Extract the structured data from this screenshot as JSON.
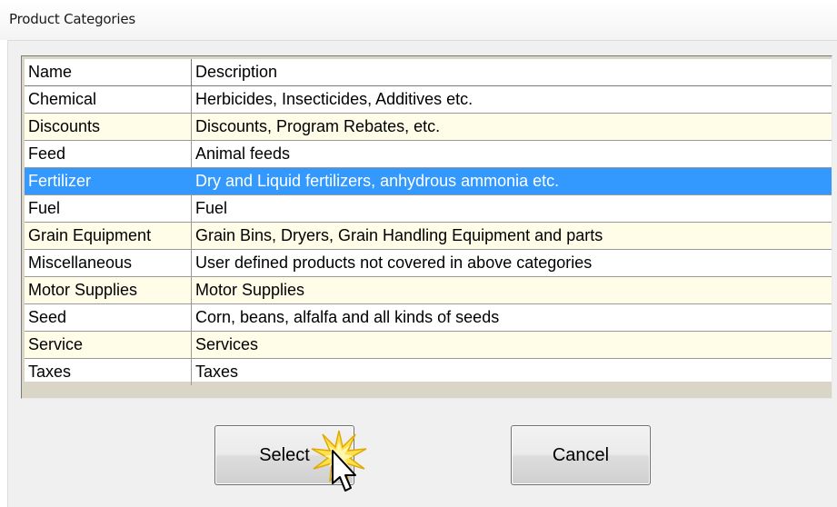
{
  "window": {
    "title": "Product Categories"
  },
  "grid": {
    "columns": [
      "Name",
      "Description"
    ],
    "rows": [
      {
        "name": "Chemical",
        "description": "Herbicides, Insecticides, Additives etc."
      },
      {
        "name": "Discounts",
        "description": "Discounts, Program Rebates, etc."
      },
      {
        "name": "Feed",
        "description": "Animal feeds"
      },
      {
        "name": "Fertilizer",
        "description": "Dry and Liquid fertilizers, anhydrous ammonia etc."
      },
      {
        "name": "Fuel",
        "description": "Fuel"
      },
      {
        "name": "Grain Equipment",
        "description": "Grain Bins, Dryers, Grain Handling Equipment and parts"
      },
      {
        "name": "Miscellaneous",
        "description": "User defined products not covered in above categories"
      },
      {
        "name": "Motor Supplies",
        "description": "Motor Supplies"
      },
      {
        "name": "Seed",
        "description": "Corn, beans, alfalfa and all kinds of seeds"
      },
      {
        "name": "Service",
        "description": "Services"
      },
      {
        "name": "Taxes",
        "description": "Taxes"
      }
    ],
    "selected_row": "Fertilizer"
  },
  "buttons": {
    "select_label": "Select",
    "cancel_label": "Cancel"
  },
  "colors": {
    "selection": "#3399ff",
    "alt_row": "#fffde8",
    "grid_background": "#d9d6c7"
  },
  "icons": {
    "click": "click-burst-icon",
    "pointer": "mouse-pointer-icon"
  }
}
